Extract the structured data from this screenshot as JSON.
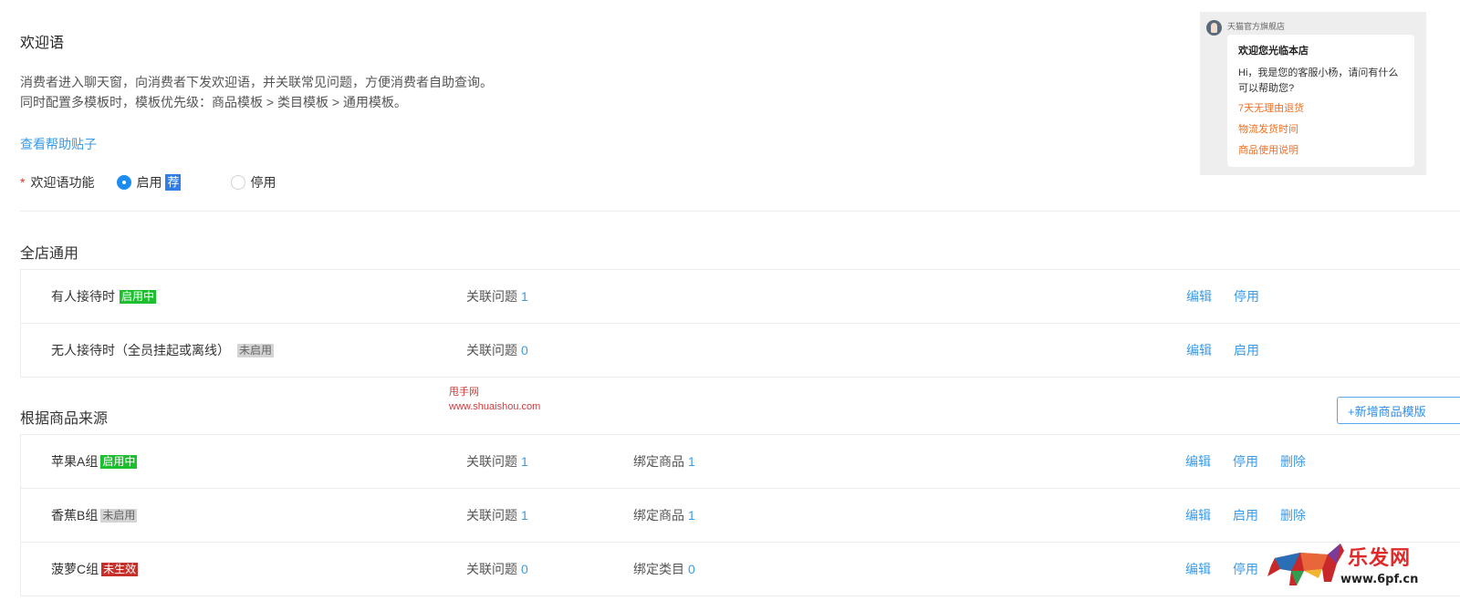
{
  "header": {
    "title": "欢迎语",
    "desc_line1": "消费者进入聊天窗，向消费者下发欢迎语，并关联常见问题，方便消费者自助查询。",
    "desc_line2": "同时配置多模板时，模板优先级：商品模板 > 类目模板 > 通用模板。",
    "help_link": "查看帮助贴子"
  },
  "switch": {
    "label": "欢迎语功能",
    "required_mark": "*",
    "enable_label": "启用",
    "recommend_tag": "荐",
    "disable_label": "停用",
    "selected": "启用"
  },
  "store_section": {
    "title": "全店通用",
    "rows": [
      {
        "name": "有人接待时",
        "status": "启用中",
        "q_label": "关联问题",
        "q_count": "1",
        "actions": [
          "编辑",
          "停用"
        ]
      },
      {
        "name": "无人接待时（全员挂起或离线）",
        "status": "未启用",
        "q_label": "关联问题",
        "q_count": "0",
        "actions": [
          "编辑",
          "启用"
        ]
      }
    ]
  },
  "product_section": {
    "title": "根据商品来源",
    "add_button": "+新增商品模版",
    "rows": [
      {
        "name": "苹果A组",
        "status": "启用中",
        "q_label": "关联问题",
        "q_count": "1",
        "bind_label": "绑定商品",
        "bind_count": "1",
        "actions": [
          "编辑",
          "停用",
          "删除"
        ]
      },
      {
        "name": "香蕉B组",
        "status": "未启用",
        "q_label": "关联问题",
        "q_count": "1",
        "bind_label": "绑定商品",
        "bind_count": "1",
        "actions": [
          "编辑",
          "启用",
          "删除"
        ]
      },
      {
        "name": "菠萝C组",
        "status": "未生效",
        "q_label": "关联问题",
        "q_count": "0",
        "bind_label": "绑定类目",
        "bind_count": "0",
        "actions": [
          "编辑",
          "停用"
        ]
      }
    ]
  },
  "preview": {
    "shop_name": "天猫官方旗舰店",
    "greeting_title": "欢迎您光临本店",
    "greeting_text": "Hi，我是您的客服小杨，请问有什么可以帮助您?",
    "questions": [
      "7天无理由退货",
      "物流发货时间",
      "商品使用说明"
    ]
  },
  "watermarks": {
    "line1": "甩手网",
    "line2": "www.shuaishou.com",
    "logo_text": "乐发网",
    "logo_url": "www.6pf.cn"
  },
  "colors": {
    "link": "#3a9be8",
    "active_badge": "#1cbf2e",
    "expired_badge": "#c62f2a",
    "question_orange": "#ef6f23"
  }
}
